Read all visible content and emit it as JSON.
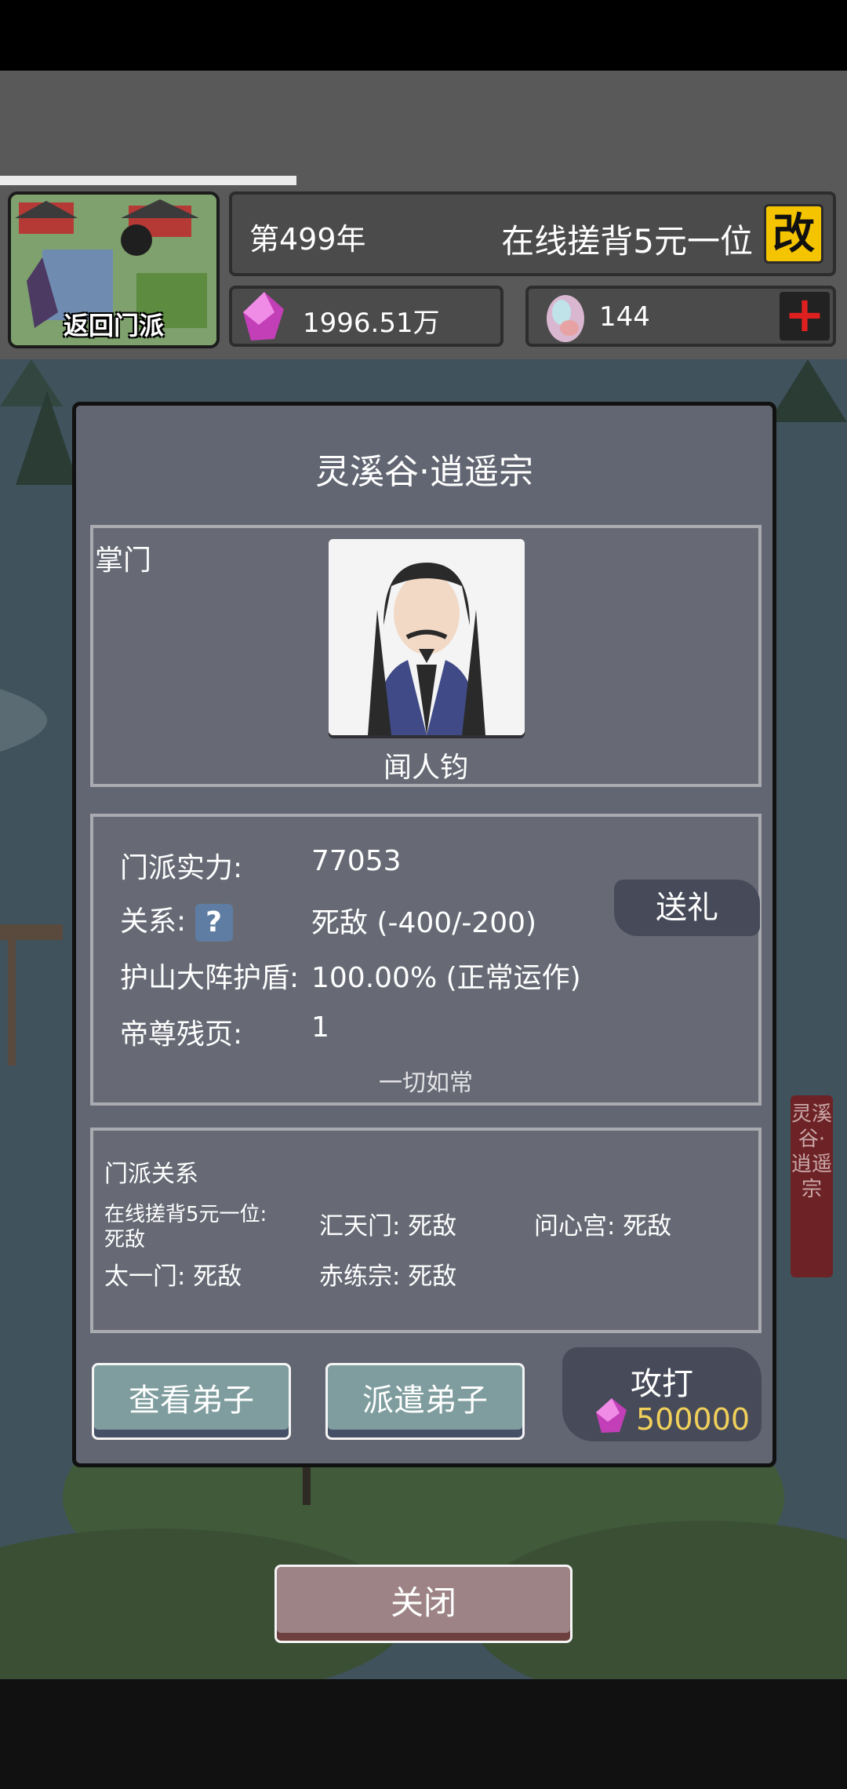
{
  "header": {
    "portal_label": "返回门派",
    "year": "第499年",
    "player_name": "在线搓背5元一位",
    "edit_label": "改",
    "progress": 0.35
  },
  "resources": {
    "spirit_stones": "1996.51万",
    "gems": "144",
    "plus_label": "+"
  },
  "panel": {
    "title": "灵溪谷·逍遥宗",
    "leader_label": "掌门",
    "leader_name": "闻人钧",
    "stats": {
      "strength_label": "门派实力:",
      "strength_value": "77053",
      "relation_label": "关系:",
      "relation_icon": "?",
      "relation_value": "死敌  (-400/-200)",
      "gift_label": "送礼",
      "shield_label": "护山大阵护盾:",
      "shield_value": "100.00% (正常运作)",
      "pages_label": "帝尊残页:",
      "pages_value": "1",
      "status_note": "一切如常"
    },
    "relations": {
      "title": "门派关系",
      "items": [
        {
          "text": "在线搓背5元一位:"
        },
        {
          "text": "死敌"
        },
        {
          "text": "汇天门: 死敌"
        },
        {
          "text": "问心宫: 死敌"
        },
        {
          "text": "太一门: 死敌"
        },
        {
          "text": "赤练宗: 死敌"
        }
      ]
    },
    "buttons": {
      "view_disciples": "查看弟子",
      "dispatch_disciples": "派遣弟子",
      "attack": "攻打",
      "attack_cost": "500000"
    }
  },
  "close_label": "关闭",
  "side_banner": "灵溪谷·逍遥宗",
  "colors": {
    "accent_gold": "#f5c400",
    "danger_red": "#e02020",
    "cost_yellow": "#f0d05a"
  }
}
